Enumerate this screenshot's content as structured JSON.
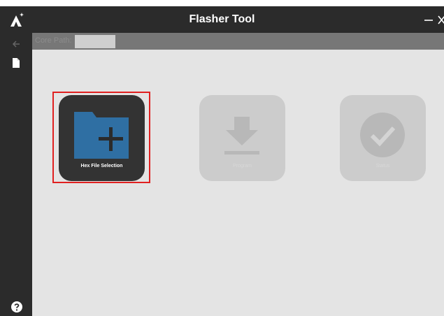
{
  "window": {
    "title": "Flasher Tool",
    "logo_icon": "tent-logo-icon",
    "controls": {
      "minimize_icon": "minimize-icon",
      "close_icon": "close-icon"
    }
  },
  "sidebar": {
    "items": [
      {
        "icon": "back-arrow-icon"
      },
      {
        "icon": "file-icon"
      },
      {
        "icon": "help-icon"
      }
    ]
  },
  "path_bar": {
    "label": "Core Path:",
    "value": ""
  },
  "tiles": [
    {
      "label": "Hex File Selection",
      "icon": "folder-add-icon",
      "enabled": true
    },
    {
      "label": "Program",
      "icon": "download-icon",
      "enabled": false
    },
    {
      "label": "Status",
      "icon": "check-circle-icon",
      "enabled": false
    }
  ],
  "colors": {
    "chrome": "#2b2b2b",
    "content_bg": "#e4e4e4",
    "path_bar": "#777777",
    "folder_blue": "#2f6fa3",
    "highlight": "#e02020"
  }
}
